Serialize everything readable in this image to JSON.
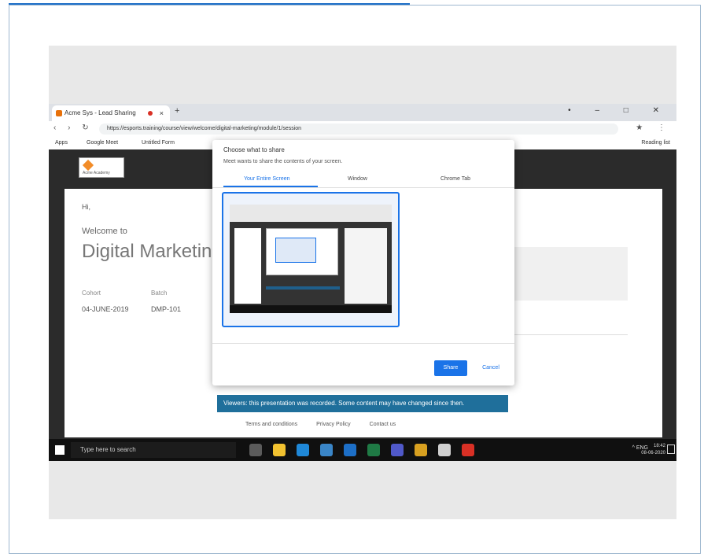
{
  "player": {
    "progress_fraction": 0.58
  },
  "browser": {
    "tab_title": "Acme Sys - Lead Sharing",
    "tab_close": "×",
    "new_tab": "+",
    "window_controls": "• – □ ✕",
    "nav_icons": "‹ › ↻",
    "url": "https://esports.training/course/view/welcome/digital-marketing/module/1/session",
    "addr_icons": "★ ⋮",
    "bookmarks": [
      "Apps",
      "Google Meet",
      "Untitled Form"
    ],
    "bookmark_right": "Reading list"
  },
  "page": {
    "logo_text": "Acme Academy",
    "greeting": "Hi,",
    "welcome": "Welcome to",
    "course_title": "Digital Marketin",
    "meta": [
      {
        "label": "Cohort",
        "value": "04-JUNE-2019"
      },
      {
        "label": "Batch",
        "value": "DMP-101"
      }
    ],
    "notice": "Viewers: this presentation was recorded. Some content may have changed since then.",
    "footer_links": [
      "Terms and conditions",
      "Privacy Policy",
      "Contact us"
    ]
  },
  "dialog": {
    "title": "Choose what to share",
    "subtitle": "Meet wants to share the contents of your screen.",
    "tabs": [
      "Your Entire Screen",
      "Window",
      "Chrome Tab"
    ],
    "share_label": "Share",
    "cancel_label": "Cancel"
  },
  "taskbar": {
    "search_placeholder": "Type here to search",
    "apps": [
      {
        "name": "task-view",
        "color": "#5b5b5b"
      },
      {
        "name": "file-explorer",
        "color": "#f2c230"
      },
      {
        "name": "edge",
        "color": "#1f88d8"
      },
      {
        "name": "store",
        "color": "#3a86c8"
      },
      {
        "name": "mail",
        "color": "#1d6fc7"
      },
      {
        "name": "excel",
        "color": "#1f7a45"
      },
      {
        "name": "teams",
        "color": "#5059c9"
      },
      {
        "name": "chrome",
        "color": "#d8a020"
      },
      {
        "name": "obs",
        "color": "#d0d0d0"
      },
      {
        "name": "acrobat",
        "color": "#d93025"
      }
    ],
    "tray_text": "^ ENG",
    "time": "18:42",
    "date": "08-06-2020"
  }
}
